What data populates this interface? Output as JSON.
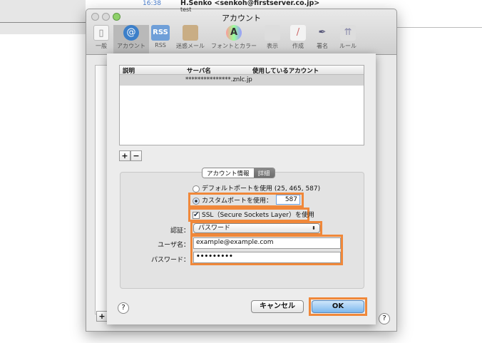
{
  "background": {
    "time": "16:38",
    "from": "H.Senko <senkoh@firstserver.co.jp>",
    "subject": "test",
    "plus_label": "+",
    "help_label": "?"
  },
  "window": {
    "title": "アカウント",
    "toolbar": [
      {
        "label": "一般",
        "icon": "switch-icon"
      },
      {
        "label": "アカウント",
        "icon": "at-icon"
      },
      {
        "label": "RSS",
        "icon": "rss-icon"
      },
      {
        "label": "迷惑メール",
        "icon": "junk-bag-icon"
      },
      {
        "label": "フォントとカラー",
        "icon": "font-icon"
      },
      {
        "label": "表示",
        "icon": "glasses-icon"
      },
      {
        "label": "作成",
        "icon": "pencil-icon"
      },
      {
        "label": "署名",
        "icon": "signature-icon"
      },
      {
        "label": "ルール",
        "icon": "rules-icon"
      }
    ]
  },
  "sheet": {
    "table": {
      "headers": [
        "説明",
        "サーバ名",
        "使用しているアカウント"
      ],
      "rows": [
        {
          "description": "",
          "server": "***************.znlc.jp",
          "account": ""
        }
      ]
    },
    "add_label": "+",
    "remove_label": "−",
    "tabs": [
      {
        "label": "アカウント情報",
        "active": false
      },
      {
        "label": "詳細",
        "active": true
      }
    ],
    "default_port_label": "デフォルトポートを使用 (25, 465, 587)",
    "custom_port_label": "カスタムポートを使用：",
    "custom_port_value": "587",
    "ssl_label": "SSL（Secure Sockets Layer）を使用",
    "ssl_checked": true,
    "auth_label": "認証：",
    "auth_value": "パスワード",
    "username_label": "ユーザ名：",
    "username_value": "example@example.com",
    "password_label": "パスワード：",
    "password_value": "•••••••••",
    "help_label": "?",
    "cancel_label": "キャンセル",
    "ok_label": "OK",
    "highlight_color": "#f0883a"
  }
}
